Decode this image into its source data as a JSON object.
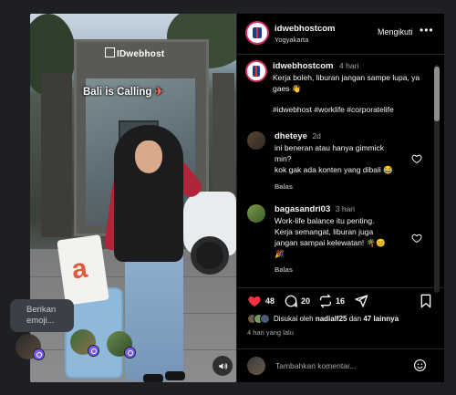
{
  "post": {
    "caption_overlay": "Bali is Calling",
    "sign_text": "IDwebhost",
    "account": {
      "username": "idwebhostcom",
      "location": "Yogyakarta",
      "follow_label": "Mengikuti",
      "more_icon": "more-horizontal-icon"
    },
    "caption": {
      "username": "idwebhostcom",
      "time": "4 hari",
      "text": "Kerja boleh, liburan jangan sampe lupa, ya gaes 👋",
      "hashtags": "#idwebhost #worklife #corporatelife"
    }
  },
  "comments": [
    {
      "username": "dheteye",
      "time": "2d",
      "lines": [
        "ini beneran atau hanya gimmick",
        "min?",
        "kok gak ada konten yang dibali 😂"
      ],
      "reply_label": "Balas"
    },
    {
      "username": "bagasandri03",
      "time": "3 hari",
      "lines": [
        "Work-life balance itu penting.",
        "Kerja semangat, liburan juga",
        "jangan sampai kelewatan! 🌴😊",
        "🎉"
      ],
      "reply_label": "Balas"
    }
  ],
  "actions": {
    "likes": "48",
    "comments": "20",
    "reposts": "16",
    "liked_by_prefix": "Disukai oleh",
    "liked_by_user": "nadialf25",
    "liked_by_connector": "dan",
    "liked_by_others": "47 lainnya",
    "timestamp": "4 hari yang lalu"
  },
  "add_comment": {
    "placeholder": "Tambahkan komentar..."
  },
  "overlay": {
    "tooltip_line1": "Berikan",
    "tooltip_line2": "emoji..."
  },
  "colors": {
    "like_red": "#ff3040",
    "link_blue": "#5aa0ff",
    "panel_bg": "#000000",
    "page_bg": "#1e1f22"
  }
}
